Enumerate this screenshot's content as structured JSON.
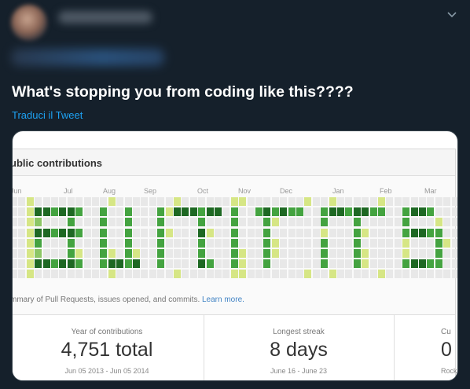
{
  "tweet": {
    "text": "What's stopping you from coding like this????",
    "translate_link": "Traduci il Tweet",
    "menu_icon": "chevron-down-icon"
  },
  "contributions": {
    "title": "ublic contributions",
    "months": [
      "Jun",
      "Jul",
      "Aug",
      "Sep",
      "Oct",
      "Nov",
      "Dec",
      "Jan",
      "Feb",
      "Mar"
    ],
    "summary_text": "mmary of Pull Requests, issues opened, and commits.",
    "learn_more": "Learn more.",
    "colors": {
      "empty": "#e8e8e8",
      "light": "#d6e685",
      "mid": "#8cc665",
      "dark": "#44a340",
      "darkest": "#1e6823"
    },
    "stats": [
      {
        "label": "Year of contributions",
        "value": "4,751 total",
        "range": "Jun 05 2013 - Jun 05 2014"
      },
      {
        "label": "Longest streak",
        "value": "8 days",
        "range": "June 16 - June 23"
      },
      {
        "label": "Cu",
        "value": "0",
        "range": "Rock"
      }
    ]
  }
}
